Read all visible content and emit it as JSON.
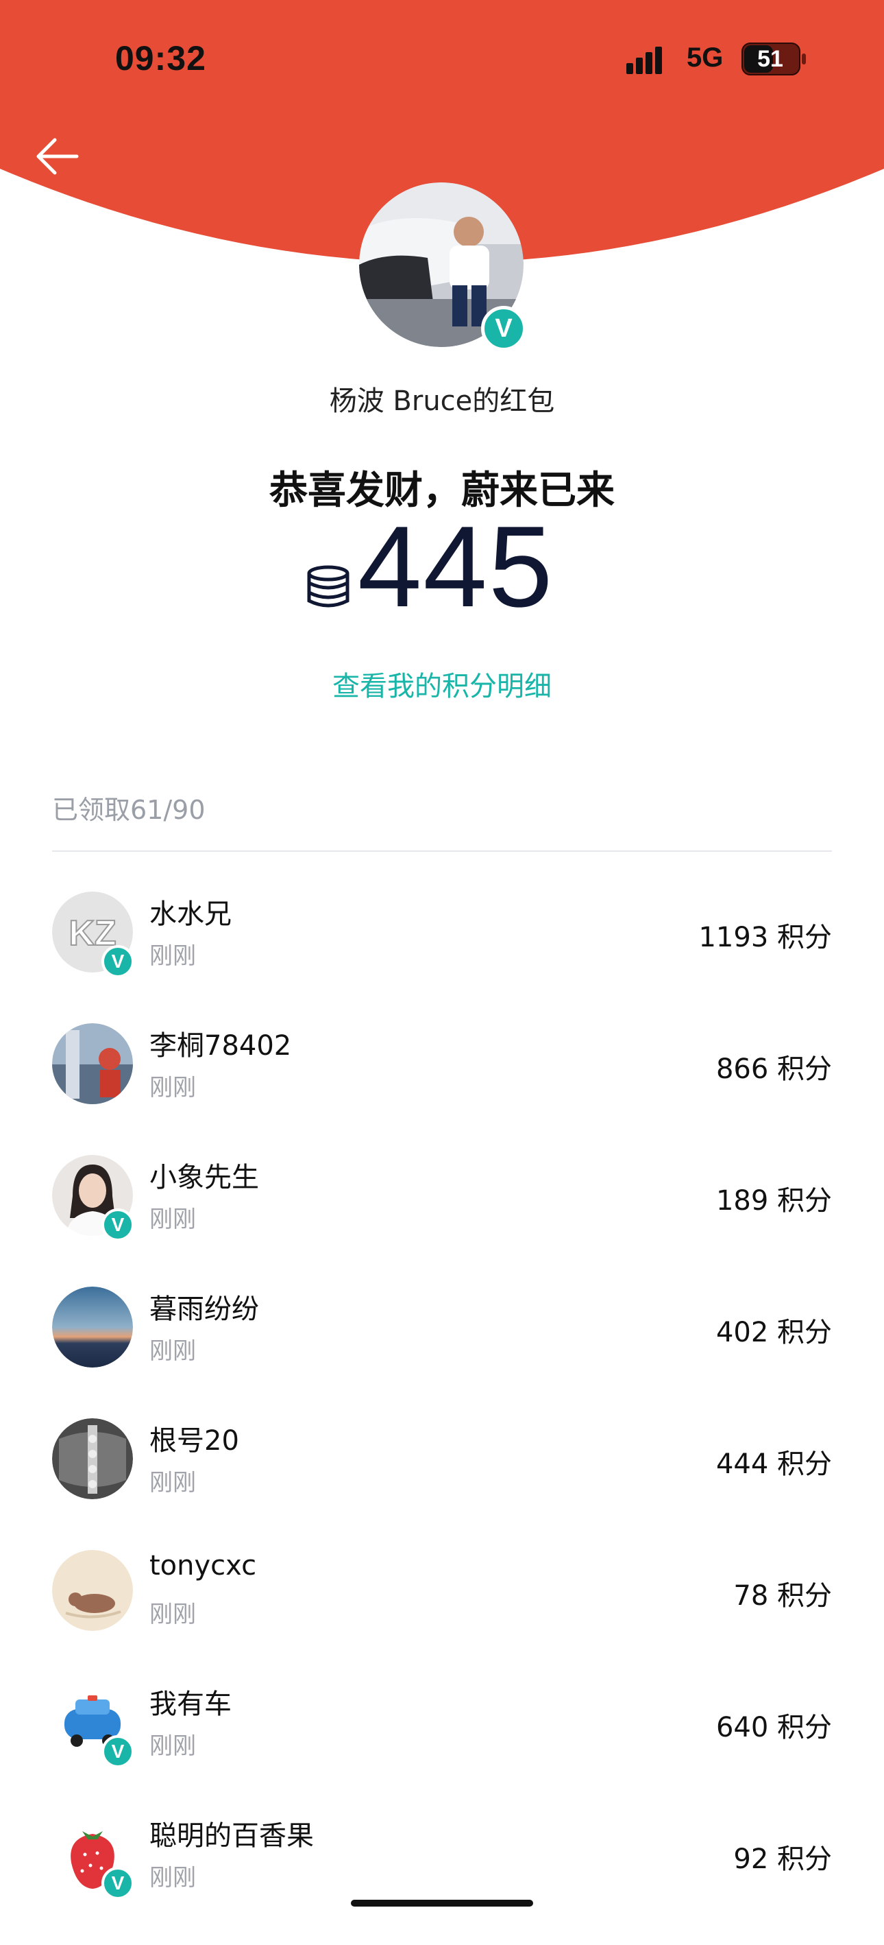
{
  "status_bar": {
    "time": "09:32",
    "network": "5G",
    "battery": "51"
  },
  "colors": {
    "header_red": "#e74c36",
    "accent_teal": "#19b5a8",
    "amount_navy": "#101733"
  },
  "header": {
    "back_icon": "arrow-left-icon"
  },
  "packet": {
    "owner": "杨波 Bruce的红包",
    "greeting": "恭喜发财，蔚来已来",
    "amount": "445",
    "coin_icon": "coin-stack-icon",
    "detail_link": "查看我的积分明细"
  },
  "claims": {
    "summary": "已领取61/90",
    "items": [
      {
        "name": "水水兄",
        "time": "刚刚",
        "points": "1193 积分",
        "verified": true
      },
      {
        "name": "李桐78402",
        "time": "刚刚",
        "points": "866 积分",
        "verified": false
      },
      {
        "name": "小象先生",
        "time": "刚刚",
        "points": "189 积分",
        "verified": true
      },
      {
        "name": "暮雨纷纷",
        "time": "刚刚",
        "points": "402 积分",
        "verified": false
      },
      {
        "name": "根号20",
        "time": "刚刚",
        "points": "444 积分",
        "verified": false
      },
      {
        "name": "tonycxc",
        "time": "刚刚",
        "points": "78 积分",
        "verified": false
      },
      {
        "name": "我有车",
        "time": "刚刚",
        "points": "640 积分",
        "verified": true
      },
      {
        "name": "聪明的百香果",
        "time": "刚刚",
        "points": "92 积分",
        "verified": true
      }
    ]
  }
}
